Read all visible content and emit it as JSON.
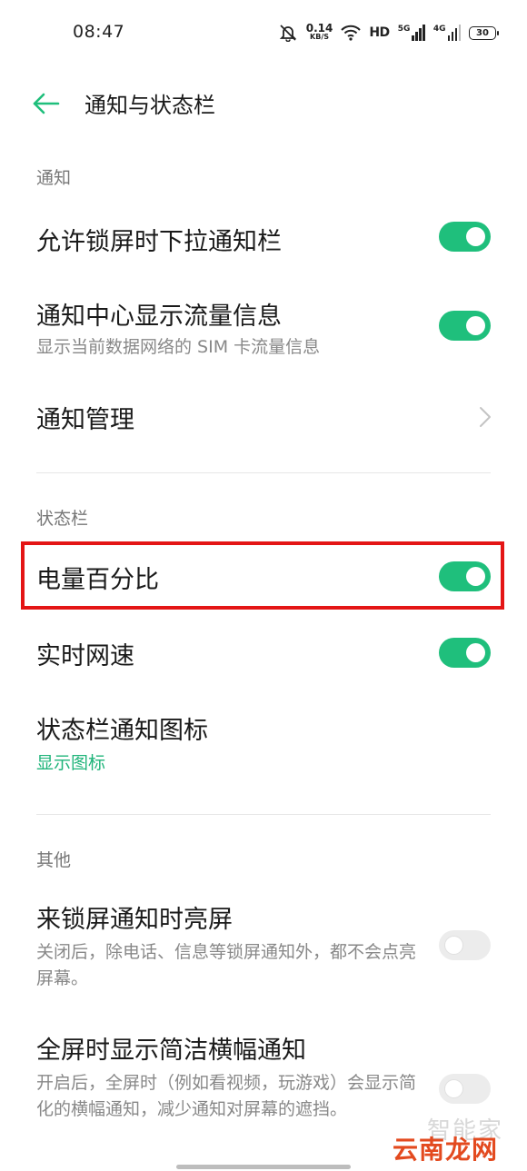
{
  "status_bar": {
    "time": "08:47",
    "speed_value": "0.14",
    "speed_unit": "KB/S",
    "hd": "HD",
    "net1": "5G",
    "net2": "4G",
    "battery": "30"
  },
  "header": {
    "title": "通知与状态栏"
  },
  "sections": {
    "notification": {
      "label": "通知",
      "items": [
        {
          "title": "允许锁屏时下拉通知栏",
          "toggle": "on"
        },
        {
          "title": "通知中心显示流量信息",
          "subtitle": "显示当前数据网络的 SIM 卡流量信息",
          "toggle": "on"
        },
        {
          "title": "通知管理"
        }
      ]
    },
    "statusbar": {
      "label": "状态栏",
      "items": [
        {
          "title": "电量百分比",
          "toggle": "on"
        },
        {
          "title": "实时网速",
          "toggle": "on"
        },
        {
          "title": "状态栏通知图标",
          "subtitle": "显示图标"
        }
      ]
    },
    "other": {
      "label": "其他",
      "items": [
        {
          "title": "来锁屏通知时亮屏",
          "subtitle": "关闭后，除电话、信息等锁屏通知外，都不会点亮屏幕。",
          "toggle": "off"
        },
        {
          "title": "全屏时显示简洁横幅通知",
          "subtitle": "开启后，全屏时（例如看视频，玩游戏）会显示简化的横幅通知，减少通知对屏幕的遮挡。",
          "toggle": "off"
        }
      ]
    }
  },
  "watermark": {
    "top": "智能家",
    "main": "云南龙网"
  },
  "colors": {
    "accent": "#1fbf7c",
    "highlight": "#e41515"
  }
}
